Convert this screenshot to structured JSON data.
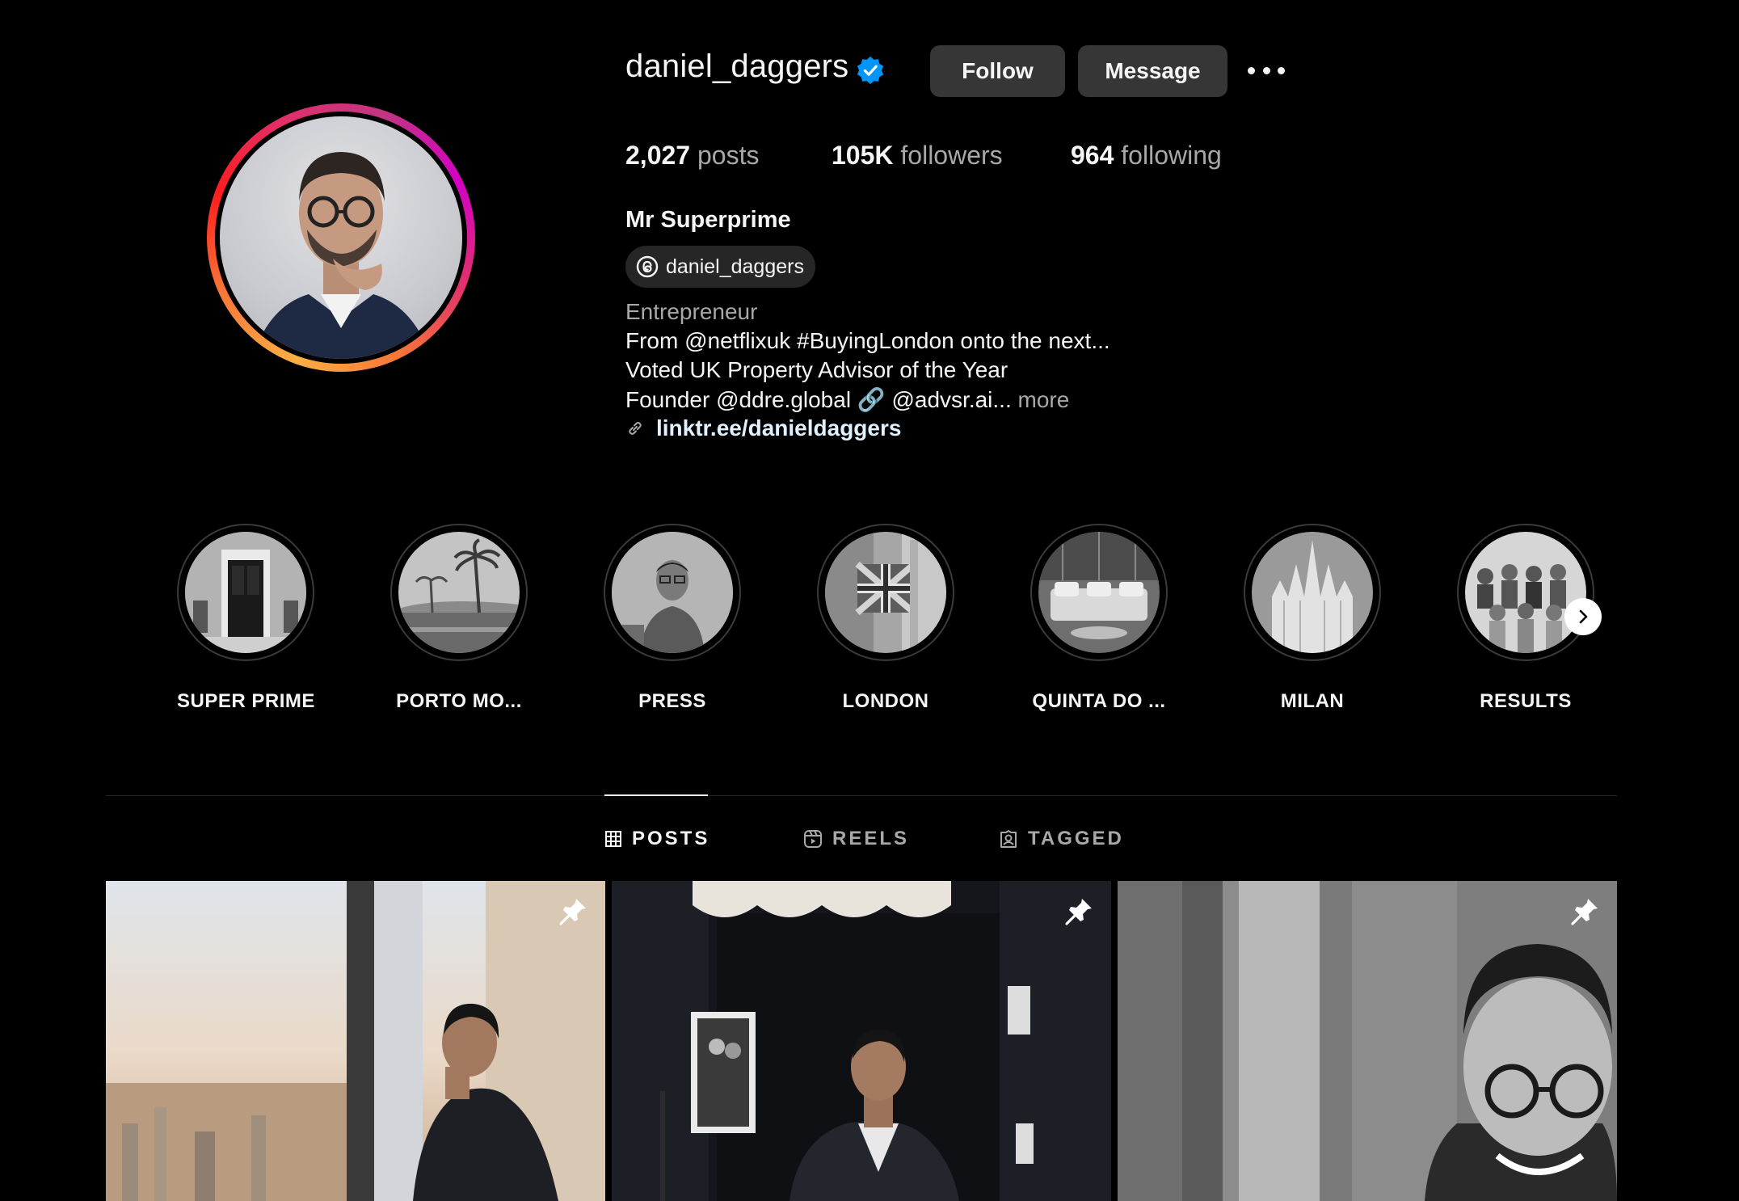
{
  "profile": {
    "username": "daniel_daggers",
    "verified_icon": "verified-badge-icon",
    "follow_label": "Follow",
    "message_label": "Message",
    "more_icon": "more-options-icon",
    "stats": {
      "posts_count": "2,027",
      "posts_label": "posts",
      "followers_count": "105K",
      "followers_label": "followers",
      "following_count": "964",
      "following_label": "following"
    },
    "full_name": "Mr Superprime",
    "threads_handle": "daniel_daggers",
    "bio": {
      "category": "Entrepreneur",
      "line1": "From @netflixuk #BuyingLondon onto the next...",
      "line2": "Voted UK Property Advisor of the Year",
      "line3": "Founder @ddre.global 🔗 @advsr.ai...",
      "more_label": "more",
      "link": "linktr.ee/danieldaggers"
    }
  },
  "highlights": [
    {
      "label": "SUPER PRIME"
    },
    {
      "label": "PORTO MO..."
    },
    {
      "label": "PRESS"
    },
    {
      "label": "LONDON"
    },
    {
      "label": "QUINTA DO ..."
    },
    {
      "label": "MILAN"
    },
    {
      "label": "RESULTS"
    }
  ],
  "tabs": [
    {
      "label": "POSTS",
      "icon": "grid-icon",
      "active": true
    },
    {
      "label": "REELS",
      "icon": "reels-icon",
      "active": false
    },
    {
      "label": "TAGGED",
      "icon": "tagged-icon",
      "active": false
    }
  ],
  "posts": [
    {
      "pinned": true,
      "icon": "pin-icon"
    },
    {
      "pinned": true,
      "icon": "pin-icon"
    },
    {
      "pinned": true,
      "icon": "pin-icon"
    }
  ],
  "colors": {
    "background": "#000000",
    "button": "#363636",
    "muted_text": "#a8a8a8",
    "link_text": "#e0f1ff",
    "verified": "#0095f6"
  }
}
